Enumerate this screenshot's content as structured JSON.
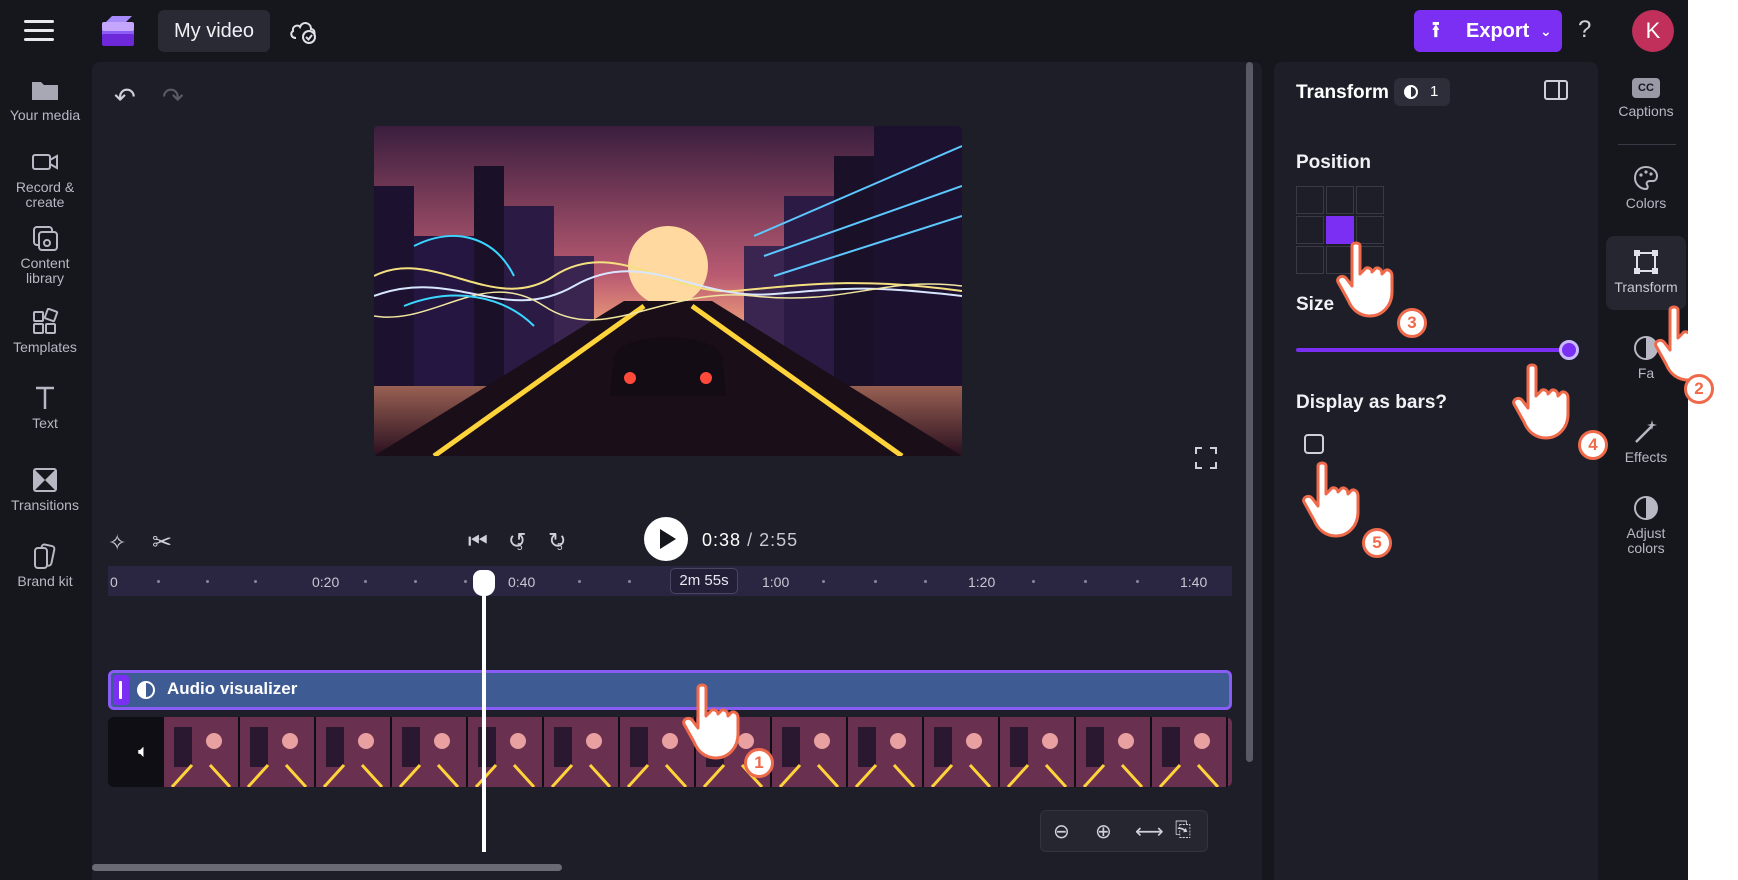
{
  "app": {
    "project_title": "My video",
    "export_label": "Export",
    "help_glyph": "?",
    "avatar_initial": "K",
    "accent_color": "#7b2ff2"
  },
  "left_nav": {
    "items": [
      {
        "label": "Your media",
        "icon": "folder-icon"
      },
      {
        "label": "Record &\ncreate",
        "icon": "camera-icon"
      },
      {
        "label": "Content\nlibrary",
        "icon": "library-icon"
      },
      {
        "label": "Templates",
        "icon": "templates-icon"
      },
      {
        "label": "Text",
        "icon": "text-icon"
      },
      {
        "label": "Transitions",
        "icon": "transitions-icon"
      },
      {
        "label": "Brand kit",
        "icon": "brand-kit-icon"
      }
    ]
  },
  "transport": {
    "current_time": "0:38",
    "total_time": "/ 2:55",
    "rewind_seconds": "5",
    "forward_seconds": "5"
  },
  "timeline": {
    "ruler_labels": [
      "0",
      "0:20",
      "0:40",
      "1:00",
      "1:20",
      "1:40"
    ],
    "duration_badge": "2m 55s",
    "playhead_time": "0:38",
    "tracks": {
      "overlay_label": "Audio visualizer",
      "video_icon": "speaker-icon"
    }
  },
  "panel": {
    "title": "Transform",
    "layer_count": "1",
    "position_label": "Position",
    "position_selected": "middle-center",
    "size_label": "Size",
    "size_value_fraction": 0.97,
    "display_bars_label": "Display as bars?",
    "display_bars_checked": false
  },
  "right_rail": {
    "items": [
      {
        "label": "Captions",
        "icon": "captions-icon",
        "badge": "CC"
      },
      {
        "label": "Colors",
        "icon": "palette-icon"
      },
      {
        "label": "Transform",
        "icon": "transform-icon",
        "active": true
      },
      {
        "label": "Fa",
        "icon": "fade-icon"
      },
      {
        "label": "Effects",
        "icon": "effects-icon"
      },
      {
        "label": "Adjust\ncolors",
        "icon": "adjust-colors-icon"
      }
    ]
  },
  "annotations": {
    "steps": [
      "1",
      "2",
      "3",
      "4",
      "5"
    ],
    "badge_color": "#ef6a4a"
  }
}
